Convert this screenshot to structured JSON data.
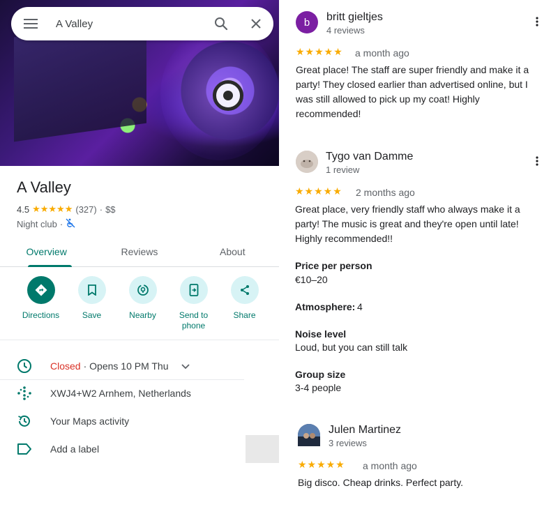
{
  "search": {
    "query": "A Valley"
  },
  "place": {
    "name": "A Valley",
    "rating": "4.5",
    "stars": "★★★★★",
    "review_count": "(327)",
    "price": "$$",
    "separator": "·",
    "category": "Night club"
  },
  "tabs": [
    {
      "label": "Overview"
    },
    {
      "label": "Reviews"
    },
    {
      "label": "About"
    }
  ],
  "actions": [
    {
      "label": "Directions",
      "icon": "directions-icon"
    },
    {
      "label": "Save",
      "icon": "bookmark-icon"
    },
    {
      "label": "Nearby",
      "icon": "nearby-icon"
    },
    {
      "label": "Send to phone",
      "icon": "send-to-phone-icon"
    },
    {
      "label": "Share",
      "icon": "share-icon"
    }
  ],
  "info": {
    "hours_status": "Closed",
    "hours_detail": "· Opens 10 PM Thu",
    "plus_code": "XWJ4+W2 Arnhem, Netherlands",
    "maps_activity": "Your Maps activity",
    "add_label": "Add a label"
  },
  "reviews": [
    {
      "avatar_letter": "b",
      "avatar_color": "#7b1fa2",
      "name": "britt gieltjes",
      "count": "4 reviews",
      "stars": "★★★★★",
      "when": "a month ago",
      "text": "Great place! The staff are super friendly and make it a party! They closed earlier than advertised online, but I was still allowed to pick up my coat! Highly recommended!"
    },
    {
      "name": "Tygo van Damme",
      "count": "1 review",
      "stars": "★★★★★",
      "when": "2 months ago",
      "text": "Great place, very friendly staff who always make it a party! The music is great and they're open until late! Highly recommended!!",
      "attributes": {
        "price_label": "Price per person",
        "price_value": "€10–20",
        "atmosphere_label": "Atmosphere:",
        "atmosphere_value": "4",
        "noise_label": "Noise level",
        "noise_value": "Loud, but you can still talk",
        "group_label": "Group size",
        "group_value": "3-4 people"
      }
    },
    {
      "name": "Julen Martinez",
      "count": "3 reviews",
      "stars": "★★★★★",
      "when": "a month ago",
      "text": "Big disco. Cheap drinks. Perfect party."
    }
  ],
  "colors": {
    "accent": "#00796b",
    "star": "#f9ab00",
    "closed": "#d93025",
    "action_bg": "#d7f3f5"
  }
}
